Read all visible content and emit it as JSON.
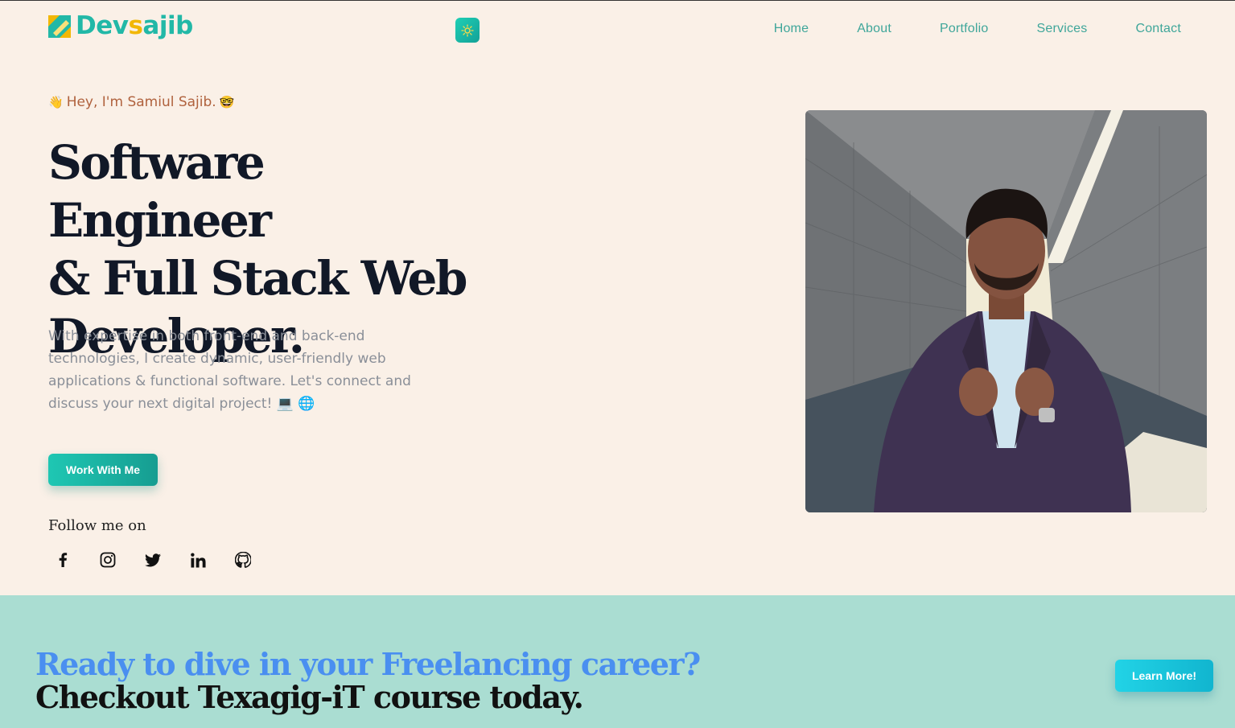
{
  "header": {
    "logo_text_1": "Dev",
    "logo_text_s": "s",
    "logo_text_2": "ajib",
    "nav": [
      "Home",
      "About",
      "Portfolio",
      "Services",
      "Contact"
    ]
  },
  "hero": {
    "greeting_wave": "👋",
    "greeting": "Hey, I'm Samiul Sajib.",
    "greeting_face": "🤓",
    "headline": [
      "Software Engineer",
      "& Full Stack Web",
      "Developer."
    ],
    "intro": "With expertise in both front-end and back-end technologies, I create dynamic, user-friendly web applications & functional software. Let's connect and discuss your next digital project!",
    "intro_emoji": "💻 🌐",
    "cta_label": "Work With Me",
    "follow_label": "Follow me on",
    "socials": [
      "facebook-icon",
      "instagram-icon",
      "twitter-icon",
      "linkedin-icon",
      "github-icon"
    ]
  },
  "band": {
    "line1": "Ready to dive in your Freelancing career?",
    "line2": "Checkout Texagig-iT course today.",
    "button_label": "Learn More!"
  },
  "colors": {
    "page_bg": "#faf0e7",
    "accent": "#22b8a7",
    "band_bg": "#aaddd2",
    "band_highlight": "#4a8ff0"
  }
}
